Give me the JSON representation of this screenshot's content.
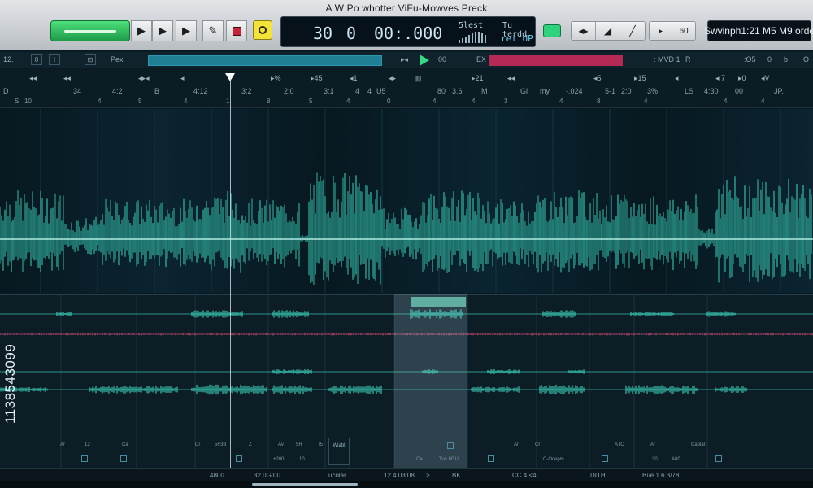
{
  "window": {
    "title": "A W Po whotter ViFu-Mowves Preck"
  },
  "transport": {
    "lcd": {
      "bars": "30",
      "beats": "0",
      "time": "00:.000",
      "signature_label": "5lest",
      "tempo_label": "Tu terdd",
      "mode_label": "ret UP"
    },
    "right_display": "Swvinph1:21 M5 M9 orde",
    "seg_icons": [
      "◂▸",
      "◢",
      "╱"
    ],
    "seg2_icons": [
      "▸",
      "60"
    ]
  },
  "toolbar_row": {
    "zoom_label": "12.",
    "box_a": "0",
    "box_b": "I",
    "box_c": "⊡",
    "pex_label": "Pex",
    "play_value": "00",
    "ex_label": "EX",
    "right_a": ": MVD 1",
    "right_b": "R",
    "right_c": ":O5",
    "right_d": "0",
    "right_e": "b",
    "right_f": "O"
  },
  "ruler_row": [
    "◂◂",
    "◂◂",
    "◂▸◂",
    "◂",
    "▸%",
    "▸45",
    "◂1",
    "◂▸",
    "▥",
    "▸21",
    "◂◂",
    "◂5",
    "▸15",
    "◂",
    "◂ 7",
    "▸0",
    "◂V"
  ],
  "numbers_row": [
    "D",
    "34",
    "4:2",
    "B",
    "4:12",
    "3:2",
    "2:0",
    "3:1",
    "4",
    "4",
    "U5",
    "80",
    "3.6",
    "M",
    "Gl",
    "my",
    "-.024",
    "5-1",
    "2:0",
    "3%",
    "LS",
    "4:30",
    "00",
    "JP."
  ],
  "subnumbers_row": [
    "S",
    "10",
    "4",
    "5",
    "4",
    "1",
    "8",
    "5",
    "4",
    "0",
    "4",
    "4",
    "3",
    "4",
    "8",
    "4",
    "4",
    "4"
  ],
  "channels": [
    {
      "label": "Ar",
      "value": "12",
      "mode": "Ca"
    },
    {
      "label": "Cr",
      "value": "5F3B",
      "mode": "Z"
    },
    {
      "label": "Av",
      "value": "5R",
      "mode": "I5"
    },
    {
      "label": "Wlabl",
      "value": "",
      "mode": ""
    },
    {
      "label": "Ca",
      "value": "Tus 8GU",
      "mode": ""
    },
    {
      "label": "Ar",
      "value": "Cr",
      "mode": "C-Ocepm"
    },
    {
      "label": "ATC",
      "value": "Ar",
      "mode": "Caplar"
    }
  ],
  "channel_controls": [
    {
      "label": "+200",
      "value": "10"
    },
    {
      "label": "30",
      "value": "A00"
    }
  ],
  "status": {
    "left": "4800",
    "a": "32 0G:00",
    "b": "ucolar",
    "c": "12 4 03:08",
    "d": ">",
    "e": "BK",
    "f": "CC.4 <4",
    "g": "DITH",
    "h": "Bue 1 6 3/78"
  },
  "watermark_side": "1138543099",
  "colors": {
    "wave": "#3ee3c9",
    "accent_red": "#b52a55",
    "accent_green": "#37d784"
  }
}
